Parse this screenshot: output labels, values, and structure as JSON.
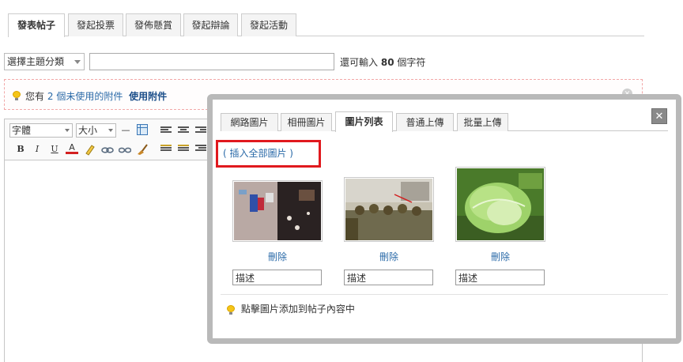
{
  "tabs": [
    "發表帖子",
    "發起投票",
    "發佈懸賞",
    "發起辯論",
    "發起活動"
  ],
  "subject": {
    "category_select": "選擇主題分類",
    "title_value": "",
    "char_prefix": "還可輸入",
    "char_count": "80",
    "char_suffix": "個字符"
  },
  "attachment_notice": {
    "prefix": "您有",
    "count": "2",
    "middle": "個未使用的附件",
    "use_link": "使用附件"
  },
  "editor": {
    "font_select": "字體",
    "size_select": "大小",
    "buttons": {
      "bold": "B",
      "italic": "I",
      "underline": "U",
      "forecolor": "A",
      "hr": "—"
    }
  },
  "modal": {
    "tabs": [
      "網路圖片",
      "相冊圖片",
      "圖片列表",
      "普通上傳",
      "批量上傳"
    ],
    "active_tab": "圖片列表",
    "close": "✕",
    "insert_all": "( 插入全部圖片 )",
    "images": [
      {
        "delete": "刪除",
        "desc_placeholder": "描述"
      },
      {
        "delete": "刪除",
        "desc_placeholder": "描述"
      },
      {
        "delete": "刪除",
        "desc_placeholder": "描述"
      }
    ],
    "tip": "點擊圖片添加到帖子內容中"
  },
  "colors": {
    "link": "#2a6aa8",
    "highlight_border": "#e0191e",
    "modal_frame": "#b9b9b9"
  }
}
